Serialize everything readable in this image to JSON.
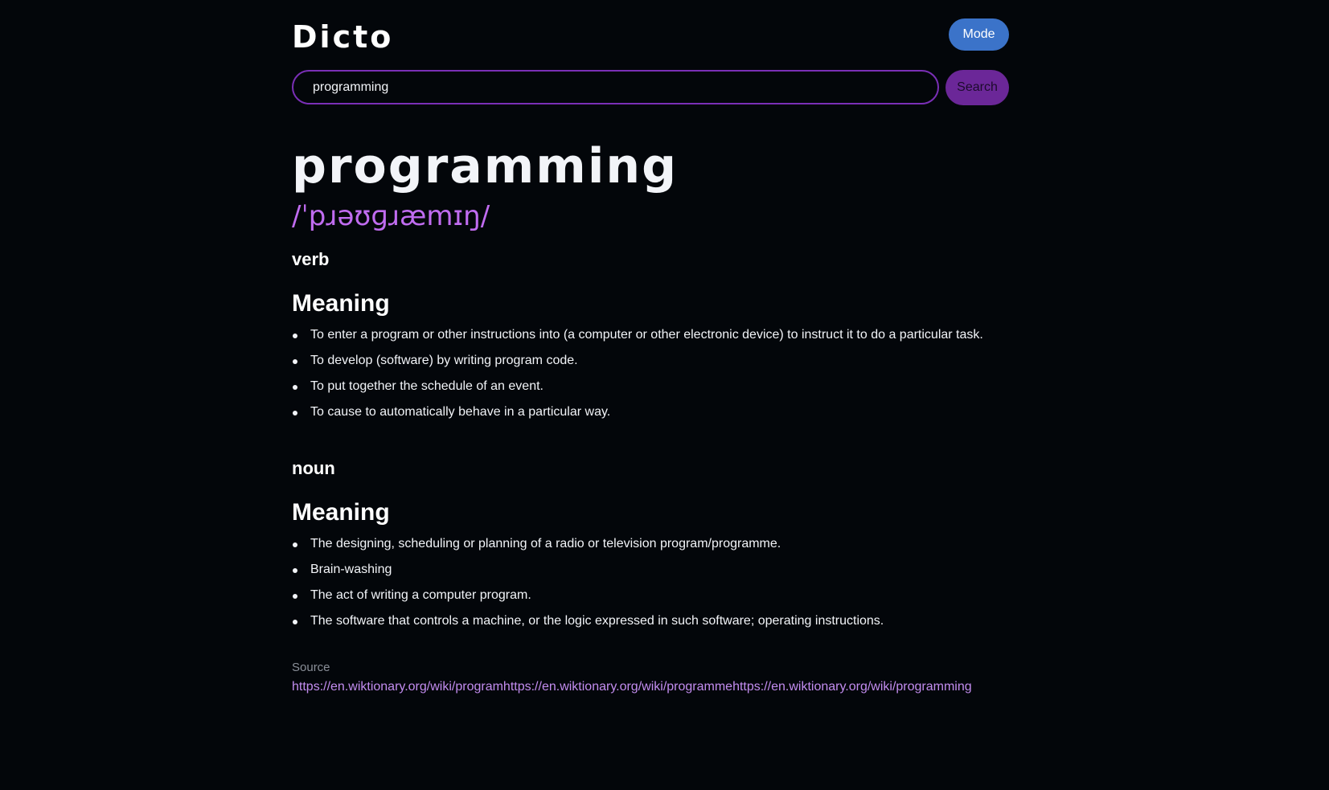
{
  "header": {
    "logo": "Dicto",
    "mode_label": "Mode"
  },
  "search": {
    "value": "programming",
    "button_label": "Search"
  },
  "entry": {
    "word": "programming",
    "phonetic": "/ˈpɹəʊɡɹæmɪŋ/",
    "meanings": [
      {
        "part_of_speech": "verb",
        "heading": "Meaning",
        "definitions": [
          "To enter a program or other instructions into (a computer or other electronic device) to instruct it to do a particular task.",
          "To develop (software) by writing program code.",
          "To put together the schedule of an event.",
          "To cause to automatically behave in a particular way."
        ]
      },
      {
        "part_of_speech": "noun",
        "heading": "Meaning",
        "definitions": [
          "The designing, scheduling or planning of a radio or television program/programme.",
          "Brain-washing",
          "The act of writing a computer program.",
          "The software that controls a machine, or the logic expressed in such software; operating instructions."
        ]
      }
    ]
  },
  "source": {
    "label": "Source",
    "links": [
      "https://en.wiktionary.org/wiki/program",
      "https://en.wiktionary.org/wiki/programme",
      "https://en.wiktionary.org/wiki/programming"
    ]
  },
  "colors": {
    "background": "#03060a",
    "mode_button": "#3b73c9",
    "search_border": "#7a2fb6",
    "search_button": "#6b2798",
    "phonetic": "#c06cf0",
    "link": "#c38df0"
  }
}
